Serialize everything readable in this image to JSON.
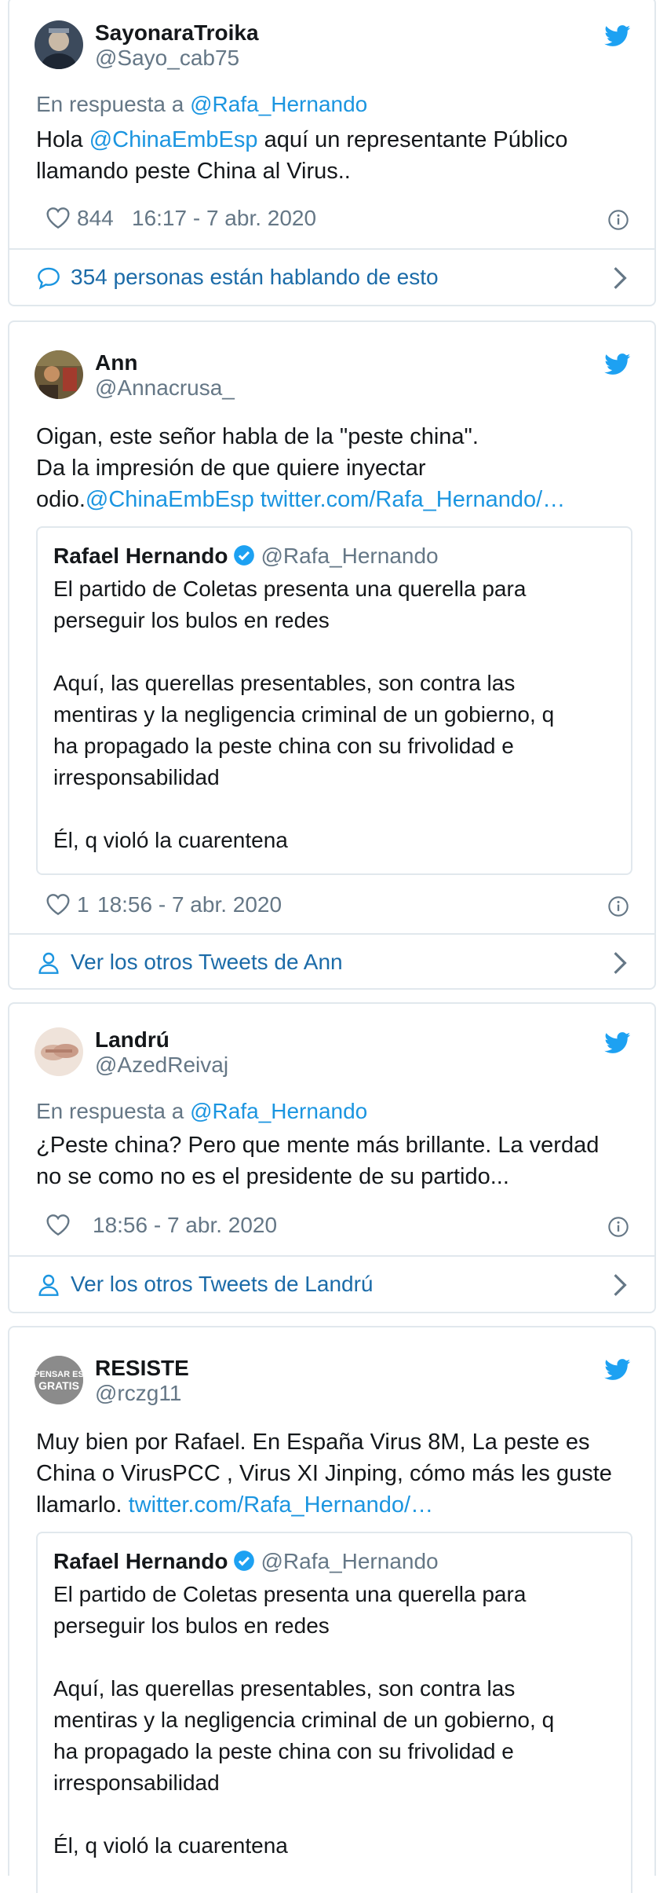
{
  "colors": {
    "link": "#1b95e0",
    "muted": "#657786",
    "border": "#e1e8ed",
    "twitter_blue": "#1da1f2"
  },
  "tweets": [
    {
      "name": "SayonaraTroika",
      "handle": "@Sayo_cab75",
      "reply_prefix": "En respuesta a",
      "reply_handle": "@Rafa_Hernando",
      "lines": [
        [
          {
            "t": "Hola "
          },
          {
            "t": "@ChinaEmbEsp",
            "link": true
          },
          {
            "t": " aquí un representante Público"
          }
        ],
        [
          {
            "t": "llamando peste China al Virus.."
          }
        ]
      ],
      "likes": "844",
      "timestamp": "16:17 - 7 abr. 2020",
      "footer_icon": "speech-bubble-icon",
      "footer_text": "354 personas están hablando de esto"
    },
    {
      "name": "Ann",
      "handle": "@Annacrusa_",
      "lines": [
        [
          {
            "t": "Oigan, este señor habla de la \"peste china\"."
          }
        ],
        [
          {
            "t": "Da la impresión de que quiere inyectar"
          }
        ],
        [
          {
            "t": "odio."
          },
          {
            "t": "@ChinaEmbEsp",
            "link": true
          },
          {
            "t": " "
          },
          {
            "t": "twitter.com/Rafa_Hernando/…",
            "link": true
          }
        ]
      ],
      "quote": {
        "name": "Rafael Hernando",
        "handle": "@Rafa_Hernando",
        "lines": [
          "El partido de Coletas presenta una querella para",
          "perseguir los bulos en redes",
          "",
          "Aquí, las querellas presentables, son contra las",
          "mentiras y la negligencia criminal de un gobierno, q",
          "ha propagado la peste china con su frivolidad e",
          "irresponsabilidad",
          "",
          "Él, q violó la cuarentena"
        ]
      },
      "likes": "1",
      "timestamp": "18:56 - 7 abr. 2020",
      "footer_icon": "person-icon",
      "footer_text": "Ver los otros Tweets de Ann"
    },
    {
      "name": "Landrú",
      "handle": "@AzedReivaj",
      "reply_prefix": "En respuesta a",
      "reply_handle": "@Rafa_Hernando",
      "lines": [
        [
          {
            "t": "¿Peste china? Pero que mente más brillante. La verdad"
          }
        ],
        [
          {
            "t": "no se como no es el presidente de su partido..."
          }
        ]
      ],
      "likes": "",
      "timestamp": "18:56 - 7 abr. 2020",
      "footer_icon": "person-icon",
      "footer_text": "Ver los otros Tweets de Landrú"
    },
    {
      "name": "RESISTE",
      "handle": "@rczg11",
      "avatar_text": [
        "PENSAR ES",
        "GRATIS"
      ],
      "lines": [
        [
          {
            "t": "Muy bien por Rafael. En España Virus 8M, La peste es"
          }
        ],
        [
          {
            "t": "China o VirusPCC , Virus XI Jinping, cómo más les guste"
          }
        ],
        [
          {
            "t": "llamarlo. "
          },
          {
            "t": "twitter.com/Rafa_Hernando/…",
            "link": true
          }
        ]
      ],
      "quote": {
        "name": "Rafael Hernando",
        "handle": "@Rafa_Hernando",
        "lines": [
          "El partido de Coletas presenta una querella para",
          "perseguir los bulos en redes",
          "",
          "Aquí, las querellas presentables, son contra las",
          "mentiras y la negligencia criminal de un gobierno, q",
          "ha propagado la peste china con su frivolidad e",
          "irresponsabilidad",
          "",
          "Él, q violó la cuarentena"
        ]
      }
    }
  ]
}
